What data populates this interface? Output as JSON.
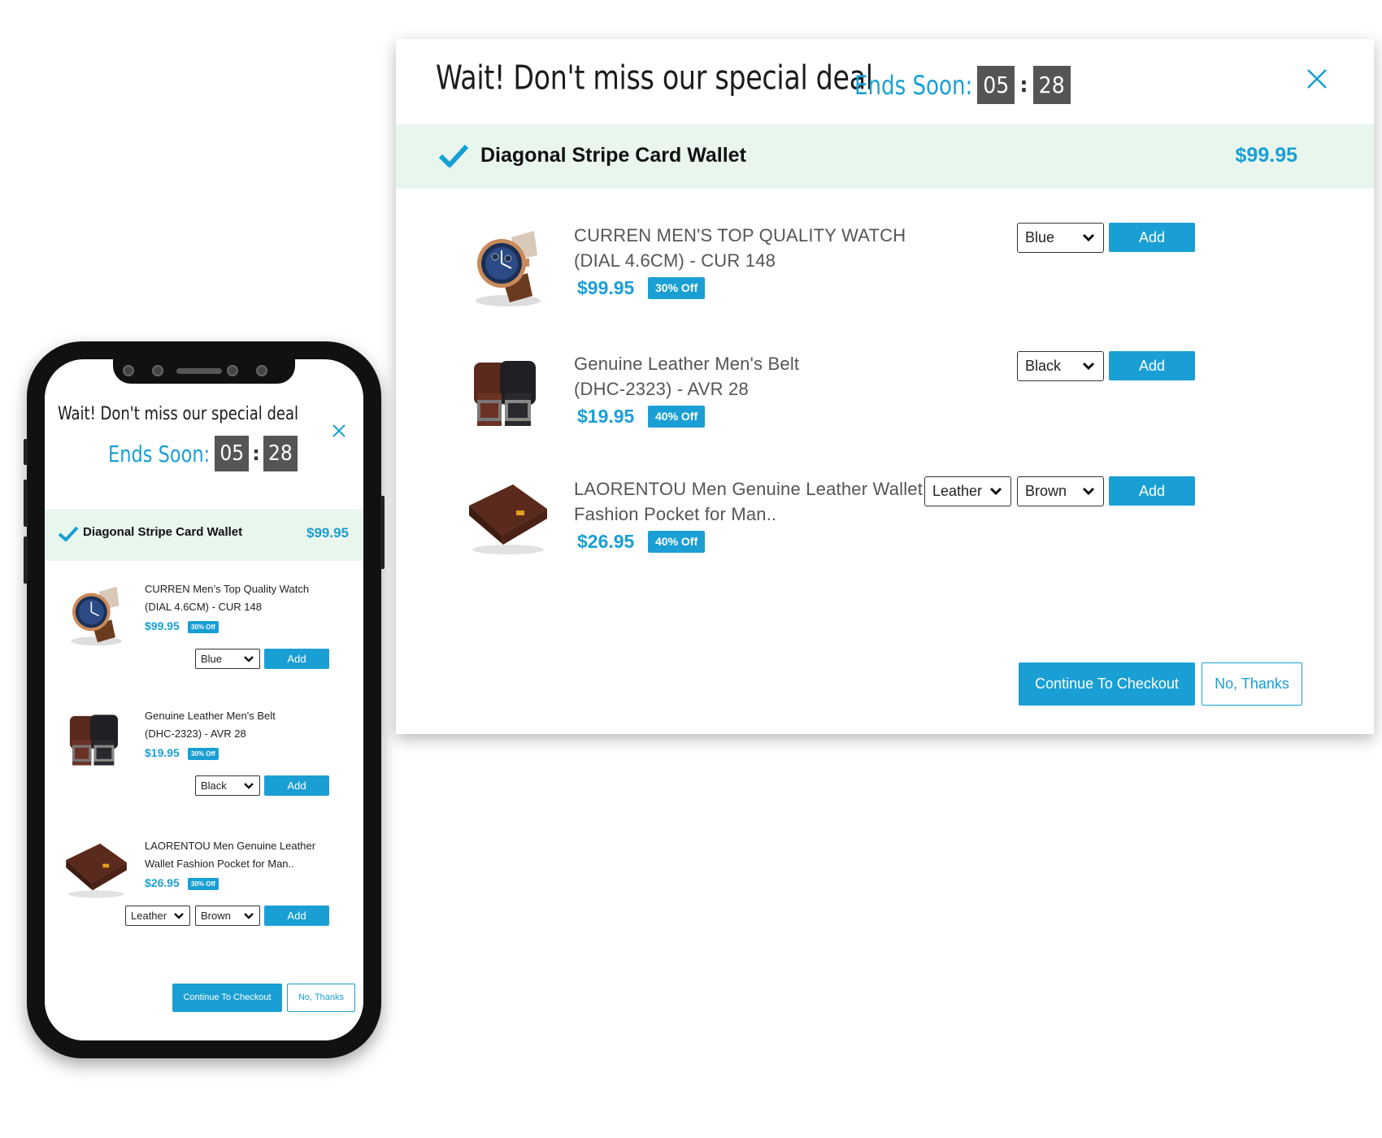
{
  "popup": {
    "title": "Wait! Don't miss our special deal",
    "ends_label": "Ends Soon:",
    "timer_minutes": "05",
    "timer_separator": ":",
    "timer_seconds": "28",
    "close_icon": "close-icon",
    "accent_color": "#1a9fd4",
    "banner_color": "#e8f6ee"
  },
  "selected_product": {
    "icon": "checkmark-icon",
    "name": "Diagonal Stripe Card Wallet",
    "price": "$99.95"
  },
  "desktop_items": [
    {
      "name_line1": "CURREN MEN'S TOP QUALITY WATCH",
      "name_line2": "(DIAL 4.6CM) - CUR 148",
      "price": "$99.95",
      "badge": "30% Off",
      "options": [
        "Blue"
      ],
      "add_label": "Add",
      "image": "watch-image"
    },
    {
      "name_line1": "Genuine Leather Men's Belt",
      "name_line2": "(DHC-2323) - AVR 28",
      "price": "$19.95",
      "badge": "40% Off",
      "options": [
        "Black"
      ],
      "add_label": "Add",
      "image": "belt-image"
    },
    {
      "name_line1": "LAORENTOU Men Genuine Leather Wallet",
      "name_line2": "Fashion Pocket for Man..",
      "price": "$26.95",
      "badge": "40% Off",
      "options": [
        "Leather",
        "Brown"
      ],
      "add_label": "Add",
      "image": "wallet-image"
    }
  ],
  "mobile_items": [
    {
      "name_line1": "CURREN Men’s Top Quality Watch",
      "name_line2": "(DIAL 4.6CM) - CUR 148",
      "price": "$99.95",
      "badge": "30% Off",
      "options": [
        "Blue"
      ],
      "add_label": "Add"
    },
    {
      "name_line1": "Genuine Leather Men's Belt",
      "name_line2": "(DHC-2323) - AVR 28",
      "price": "$19.95",
      "badge": "30% Off",
      "options": [
        "Black"
      ],
      "add_label": "Add"
    },
    {
      "name_line1": "LAORENTOU Men Genuine Leather",
      "name_line2": "Wallet Fashion Pocket for Man..",
      "price": "$26.95",
      "badge": "30% Off",
      "options": [
        "Leather",
        "Brown"
      ],
      "add_label": "Add"
    }
  ],
  "footer": {
    "checkout_label": "Continue To Checkout",
    "decline_label": "No, Thanks"
  }
}
